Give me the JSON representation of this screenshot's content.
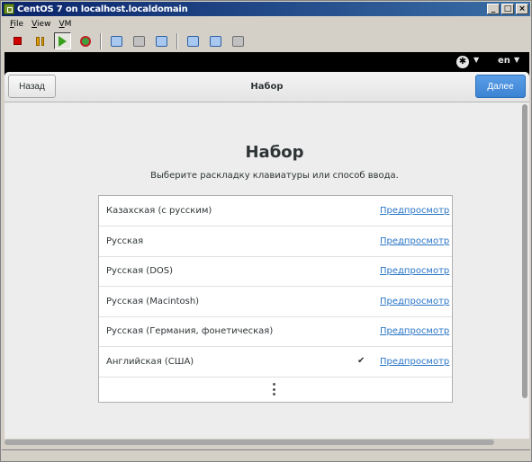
{
  "window": {
    "title": "CentOS 7 on localhost.localdomain",
    "minimize": "_",
    "maximize": "□",
    "close": "×"
  },
  "menubar": {
    "items": [
      {
        "label": "File",
        "underline": "F",
        "rest": "ile"
      },
      {
        "label": "View",
        "underline": "V",
        "rest": "iew"
      },
      {
        "label": "VM",
        "underline": "V",
        "rest": "M"
      }
    ]
  },
  "toolbar": {
    "icons": [
      "stop-icon",
      "pause-icon",
      "play-icon",
      "reset-icon",
      "snapshot-icon",
      "snapshot-manager-icon",
      "snapshot-restore-icon",
      "send-keys-icon",
      "settings-icon",
      "vm-settings-icon"
    ]
  },
  "topbar": {
    "accessibility_icon": "accessibility-icon",
    "language": "en"
  },
  "header": {
    "back_label": "Назад",
    "title": "Набор",
    "next_label": "Далее"
  },
  "page": {
    "heading": "Набор",
    "subtitle": "Выберите раскладку клавиатуры или способ ввода."
  },
  "layouts": [
    {
      "name": "Казахская (с русским)",
      "preview": "Предпросмотр",
      "selected": false
    },
    {
      "name": "Русская",
      "preview": "Предпросмотр",
      "selected": false
    },
    {
      "name": "Русская (DOS)",
      "preview": "Предпросмотр",
      "selected": false
    },
    {
      "name": "Русская (Macintosh)",
      "preview": "Предпросмотр",
      "selected": false
    },
    {
      "name": "Русская (Германия, фонетическая)",
      "preview": "Предпросмотр",
      "selected": false
    },
    {
      "name": "Английская (США)",
      "preview": "Предпросмотр",
      "selected": true,
      "check": "✔"
    }
  ],
  "colors": {
    "accent": "#3b83d4",
    "link": "#2a76c6",
    "title_bar": "#0a246a"
  }
}
